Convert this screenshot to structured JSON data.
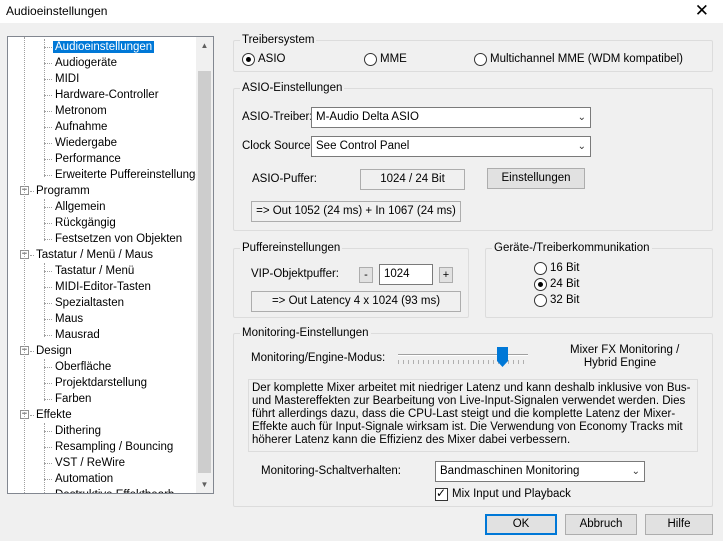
{
  "window": {
    "title": "Audioeinstellungen",
    "close_glyph": "✕"
  },
  "tree": {
    "items": [
      {
        "label": "Audioeinstellungen",
        "level": 1,
        "selected": true
      },
      {
        "label": "Audiogeräte",
        "level": 1
      },
      {
        "label": "MIDI",
        "level": 1
      },
      {
        "label": "Hardware-Controller",
        "level": 1
      },
      {
        "label": "Metronom",
        "level": 1
      },
      {
        "label": "Aufnahme",
        "level": 1
      },
      {
        "label": "Wiedergabe",
        "level": 1
      },
      {
        "label": "Performance",
        "level": 1
      },
      {
        "label": "Erweiterte Puffereinstellungen",
        "level": 1
      },
      {
        "label": "Programm",
        "level": 0,
        "expander": "−"
      },
      {
        "label": "Allgemein",
        "level": 1
      },
      {
        "label": "Rückgängig",
        "level": 1
      },
      {
        "label": "Festsetzen von Objekten",
        "level": 1
      },
      {
        "label": "Tastatur / Menü / Maus",
        "level": 0,
        "expander": "−"
      },
      {
        "label": "Tastatur / Menü",
        "level": 1
      },
      {
        "label": "MIDI-Editor-Tasten",
        "level": 1
      },
      {
        "label": "Spezialtasten",
        "level": 1
      },
      {
        "label": "Maus",
        "level": 1
      },
      {
        "label": "Mausrad",
        "level": 1
      },
      {
        "label": "Design",
        "level": 0,
        "expander": "−"
      },
      {
        "label": "Oberfläche",
        "level": 1
      },
      {
        "label": "Projektdarstellung",
        "level": 1
      },
      {
        "label": "Farben",
        "level": 1
      },
      {
        "label": "Effekte",
        "level": 0,
        "expander": "−"
      },
      {
        "label": "Dithering",
        "level": 1
      },
      {
        "label": "Resampling / Bouncing",
        "level": 1
      },
      {
        "label": "VST / ReWire",
        "level": 1
      },
      {
        "label": "Automation",
        "level": 1
      },
      {
        "label": "Destruktive Effektbearb.",
        "level": 1
      }
    ]
  },
  "treiber": {
    "title": "Treibersystem",
    "options": [
      "ASIO",
      "MME",
      "Multichannel MME (WDM kompatibel)"
    ],
    "selected": "ASIO"
  },
  "asio": {
    "title": "ASIO-Einstellungen",
    "driver_label": "ASIO-Treiber:",
    "driver_value": "M-Audio Delta ASIO",
    "clock_label": "Clock Source:",
    "clock_value": "See Control Panel",
    "buffer_label": "ASIO-Puffer:",
    "buffer_value": "1024 / 24 Bit",
    "settings_button": "Einstellungen",
    "latency": "=> Out 1052 (24 ms) + In 1067 (24 ms)"
  },
  "puffer": {
    "title": "Puffereinstellungen",
    "vip_label": "VIP-Objektpuffer:",
    "vip_value": "1024",
    "minus": "-",
    "plus": "+",
    "latency": "=> Out Latency 4 x 1024 (93 ms)"
  },
  "geraete": {
    "title": "Geräte-/Treiberkommunikation",
    "options": [
      "16 Bit",
      "24 Bit",
      "32 Bit"
    ],
    "selected": "24 Bit"
  },
  "monitoring": {
    "title": "Monitoring-Einstellungen",
    "mode_label": "Monitoring/Engine-Modus:",
    "mode_value_line1": "Mixer FX Monitoring /",
    "mode_value_line2": "Hybrid Engine",
    "slider_level": 0.8,
    "description": "Der komplette Mixer arbeitet mit niedriger Latenz und kann deshalb inklusive von Bus- und Mastereffekten zur Bearbeitung von Live-Input-Signalen verwendet werden. Dies führt allerdings dazu, dass die CPU-Last steigt und die komplette Latenz der Mixer-Effekte auch für Input-Signale wirksam ist. Die Verwendung von Economy Tracks mit höherer Latenz kann die Effizienz des Mixer dabei verbessern.",
    "behavior_label": "Monitoring-Schaltverhalten:",
    "behavior_value": "Bandmaschinen Monitoring",
    "mix_checkbox_label": "Mix Input und Playback",
    "mix_checked": true
  },
  "buttons": {
    "ok": "OK",
    "cancel": "Abbruch",
    "help": "Hilfe"
  },
  "colors": {
    "selection": "#0078d7",
    "slider_thumb": "#0078d7"
  }
}
